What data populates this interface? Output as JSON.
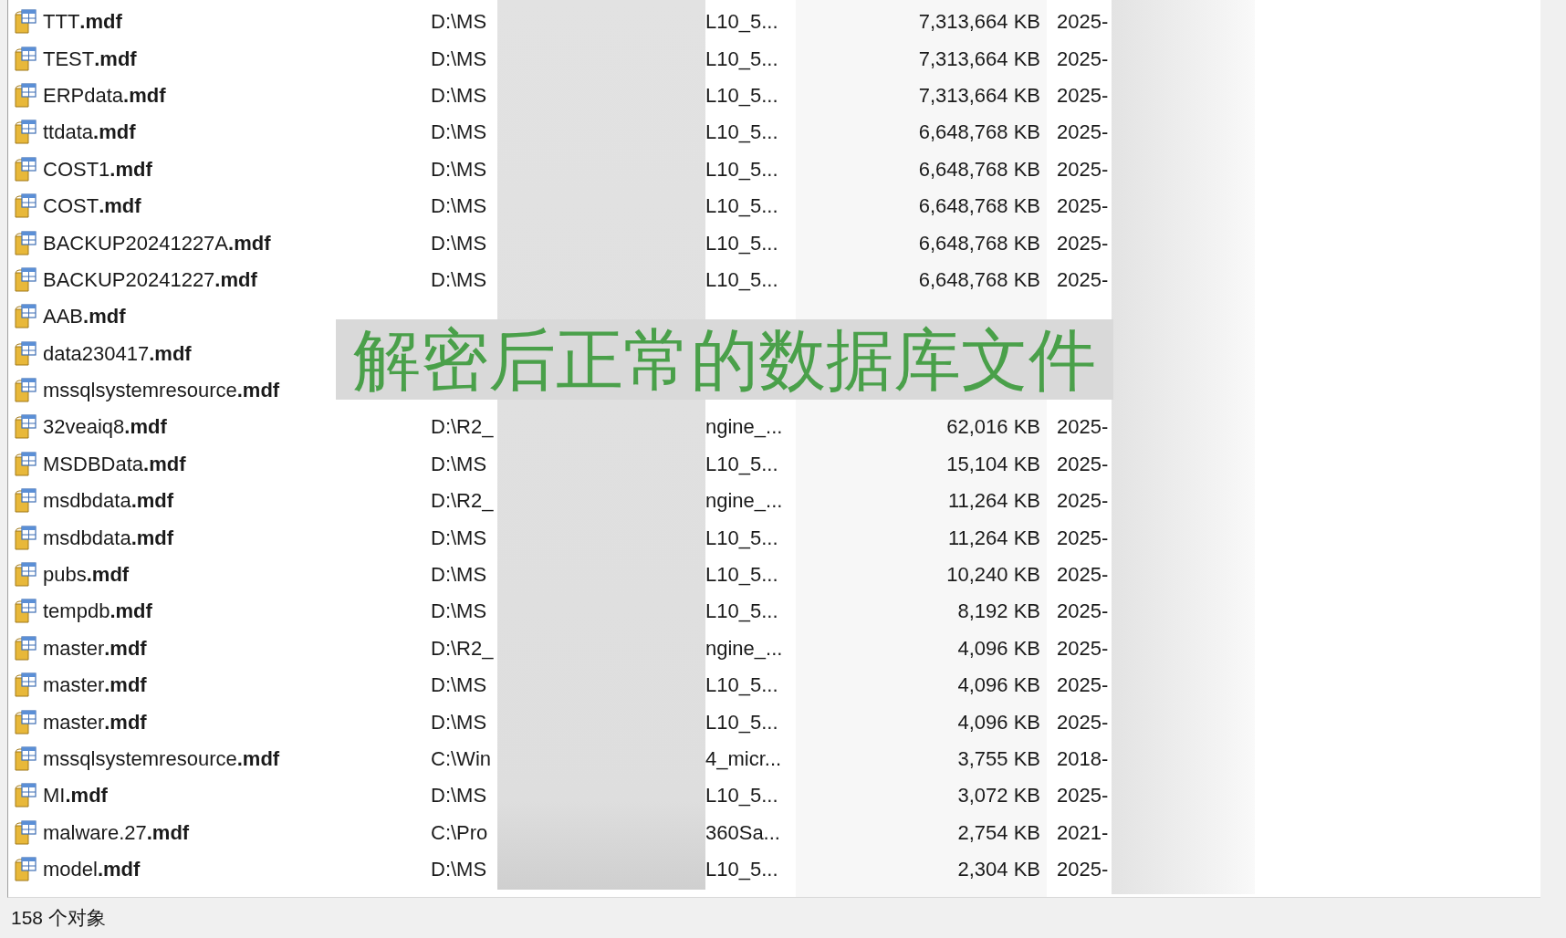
{
  "files": [
    {
      "name": "TTT**.mdf**",
      "path": "D:\\MS",
      "type": "L10_5...",
      "size": "7,313,664 KB",
      "date": "2025-"
    },
    {
      "name": "TEST**.mdf**",
      "path": "D:\\MS",
      "type": "L10_5...",
      "size": "7,313,664 KB",
      "date": "2025-"
    },
    {
      "name": "ERPdata**.mdf**",
      "path": "D:\\MS",
      "type": "L10_5...",
      "size": "7,313,664 KB",
      "date": "2025-"
    },
    {
      "name": "ttdata**.mdf**",
      "path": "D:\\MS",
      "type": "L10_5...",
      "size": "6,648,768 KB",
      "date": "2025-"
    },
    {
      "name": "COST1**.mdf**",
      "path": "D:\\MS",
      "type": "L10_5...",
      "size": "6,648,768 KB",
      "date": "2025-"
    },
    {
      "name": "COST**.mdf**",
      "path": "D:\\MS",
      "type": "L10_5...",
      "size": "6,648,768 KB",
      "date": "2025-"
    },
    {
      "name": "BACKUP20241227A**.mdf**",
      "path": "D:\\MS",
      "type": "L10_5...",
      "size": "6,648,768 KB",
      "date": "2025-"
    },
    {
      "name": "BACKUP20241227**.mdf**",
      "path": "D:\\MS",
      "type": "L10_5...",
      "size": "6,648,768 KB",
      "date": "2025-"
    },
    {
      "name": "AAB**.mdf**"
    },
    {
      "name": "data230417**.mdf**"
    },
    {
      "name": "mssqlsystemresource**.mdf**"
    },
    {
      "name": "32veaiq8**.mdf**",
      "path": "D:\\R2_",
      "type": "ngine_...",
      "size": "62,016 KB",
      "date": "2025-"
    },
    {
      "name": "MSDBData**.mdf**",
      "path": "D:\\MS",
      "type": "L10_5...",
      "size": "15,104 KB",
      "date": "2025-"
    },
    {
      "name": "msdbdata**.mdf**",
      "path": "D:\\R2_",
      "type": "ngine_...",
      "size": "11,264 KB",
      "date": "2025-"
    },
    {
      "name": "msdbdata**.mdf**",
      "path": "D:\\MS",
      "type": "L10_5...",
      "size": "11,264 KB",
      "date": "2025-"
    },
    {
      "name": "pubs**.mdf**",
      "path": "D:\\MS",
      "type": "L10_5...",
      "size": "10,240 KB",
      "date": "2025-"
    },
    {
      "name": "tempdb**.mdf**",
      "path": "D:\\MS",
      "type": "L10_5...",
      "size": "8,192 KB",
      "date": "2025-"
    },
    {
      "name": "master**.mdf**",
      "path": "D:\\R2_",
      "type": "ngine_...",
      "size": "4,096 KB",
      "date": "2025-"
    },
    {
      "name": "master**.mdf**",
      "path": "D:\\MS",
      "type": "L10_5...",
      "size": "4,096 KB",
      "date": "2025-"
    },
    {
      "name": "master**.mdf**",
      "path": "D:\\MS",
      "type": "L10_5...",
      "size": "4,096 KB",
      "date": "2025-"
    },
    {
      "name": "mssqlsystemresource**.mdf**",
      "path": "C:\\Win",
      "type": "4_micr...",
      "size": "3,755 KB",
      "date": "2018-"
    },
    {
      "name": "MI**.mdf**",
      "path": "D:\\MS",
      "type": "L10_5...",
      "size": "3,072 KB",
      "date": "2025-"
    },
    {
      "name": "malware.27**.mdf**",
      "path": "C:\\Pro",
      "type": "360Sa...",
      "size": "2,754 KB",
      "date": "2021-"
    },
    {
      "name": "model**.mdf**",
      "path": "D:\\MS",
      "type": "L10_5...",
      "size": "2,304 KB",
      "date": "2025-"
    }
  ],
  "overlay_caption": "解密后正常的数据库文件",
  "status_bar": "158 个对象"
}
